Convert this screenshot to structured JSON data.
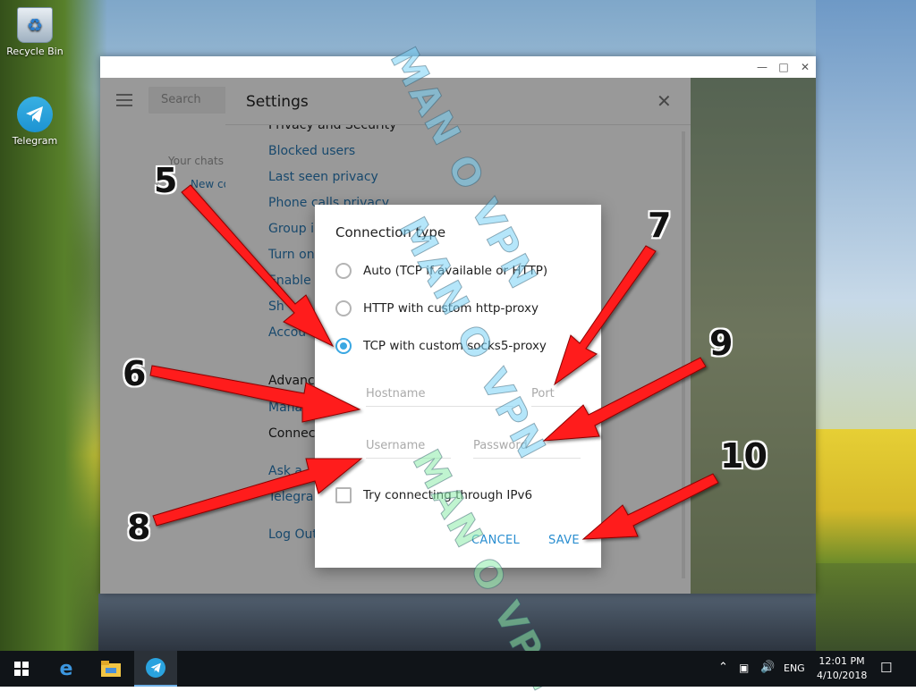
{
  "desktop": {
    "icons": [
      {
        "label": "Recycle Bin",
        "icon": "recycle-bin-icon"
      },
      {
        "label": "Telegram",
        "icon": "telegram-icon"
      }
    ]
  },
  "app": {
    "search_placeholder": "Search",
    "chats_empty": "Your chats",
    "new_chat": "New co"
  },
  "settings": {
    "title": "Settings",
    "items": [
      {
        "label": "Privacy and Security",
        "kind": "head"
      },
      {
        "label": "Blocked users",
        "kind": "link"
      },
      {
        "label": "Last seen privacy",
        "kind": "link"
      },
      {
        "label": "Phone calls privacy",
        "kind": "link"
      },
      {
        "label": "Group i",
        "kind": "link"
      },
      {
        "label": "Turn on",
        "kind": "link"
      },
      {
        "label": "Enable t",
        "kind": "link"
      },
      {
        "label": "Sh",
        "kind": "link"
      },
      {
        "label": "Accou",
        "kind": "link"
      },
      {
        "label": "Advanc",
        "kind": "head"
      },
      {
        "label": "Manag",
        "kind": "link"
      },
      {
        "label": "Connect",
        "kind": "plain"
      },
      {
        "label": "Ask a",
        "kind": "link"
      },
      {
        "label": "Telegra",
        "kind": "link"
      },
      {
        "label": "Log Out",
        "kind": "link"
      }
    ]
  },
  "dialog": {
    "title": "Connection type",
    "options": [
      {
        "label": "Auto (TCP if available or HTTP)",
        "selected": false
      },
      {
        "label": "HTTP with custom http-proxy",
        "selected": false
      },
      {
        "label": "TCP with custom socks5-proxy",
        "selected": true
      }
    ],
    "hostname_placeholder": "Hostname",
    "port_placeholder": "Port",
    "username_placeholder": "Username",
    "password_placeholder": "Password",
    "ipv6_label": "Try connecting through IPv6",
    "ipv6_checked": false,
    "cancel_label": "CANCEL",
    "save_label": "SAVE"
  },
  "annotations": {
    "numbers": [
      "5",
      "6",
      "7",
      "8",
      "9",
      "10"
    ],
    "arrow_color": "#ff1a1a"
  },
  "watermarks": [
    "MAN O VPN",
    "MAN O VPN",
    "MAN O VPN"
  ],
  "taskbar": {
    "language": "ENG",
    "time": "12:01 PM",
    "date": "4/10/2018"
  }
}
